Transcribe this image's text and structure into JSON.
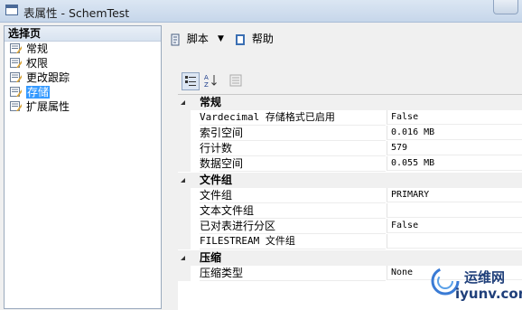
{
  "window": {
    "title": "表属性 - SchemTest"
  },
  "left_pane": {
    "header": "选择页",
    "items": [
      {
        "label": "常规",
        "selected": false
      },
      {
        "label": "权限",
        "selected": false
      },
      {
        "label": "更改跟踪",
        "selected": false
      },
      {
        "label": "存储",
        "selected": true
      },
      {
        "label": "扩展属性",
        "selected": false
      }
    ]
  },
  "toolbar": {
    "script_label": "脚本",
    "help_label": "帮助"
  },
  "property_grid": {
    "categories": [
      {
        "label": "常规",
        "rows": [
          {
            "name": "Vardecimal 存储格式已启用",
            "value": "False"
          },
          {
            "name": "索引空间",
            "value": "0.016 MB"
          },
          {
            "name": "行计数",
            "value": "579"
          },
          {
            "name": "数据空间",
            "value": "0.055 MB"
          }
        ]
      },
      {
        "label": "文件组",
        "rows": [
          {
            "name": "文件组",
            "value": "PRIMARY"
          },
          {
            "name": "文本文件组",
            "value": ""
          },
          {
            "name": "已对表进行分区",
            "value": "False"
          },
          {
            "name": "FILESTREAM 文件组",
            "value": ""
          }
        ]
      },
      {
        "label": "压缩",
        "rows": [
          {
            "name": "压缩类型",
            "value": "None"
          }
        ]
      }
    ]
  },
  "watermark": {
    "line1": "运维网",
    "line2": "iyunv.com"
  }
}
